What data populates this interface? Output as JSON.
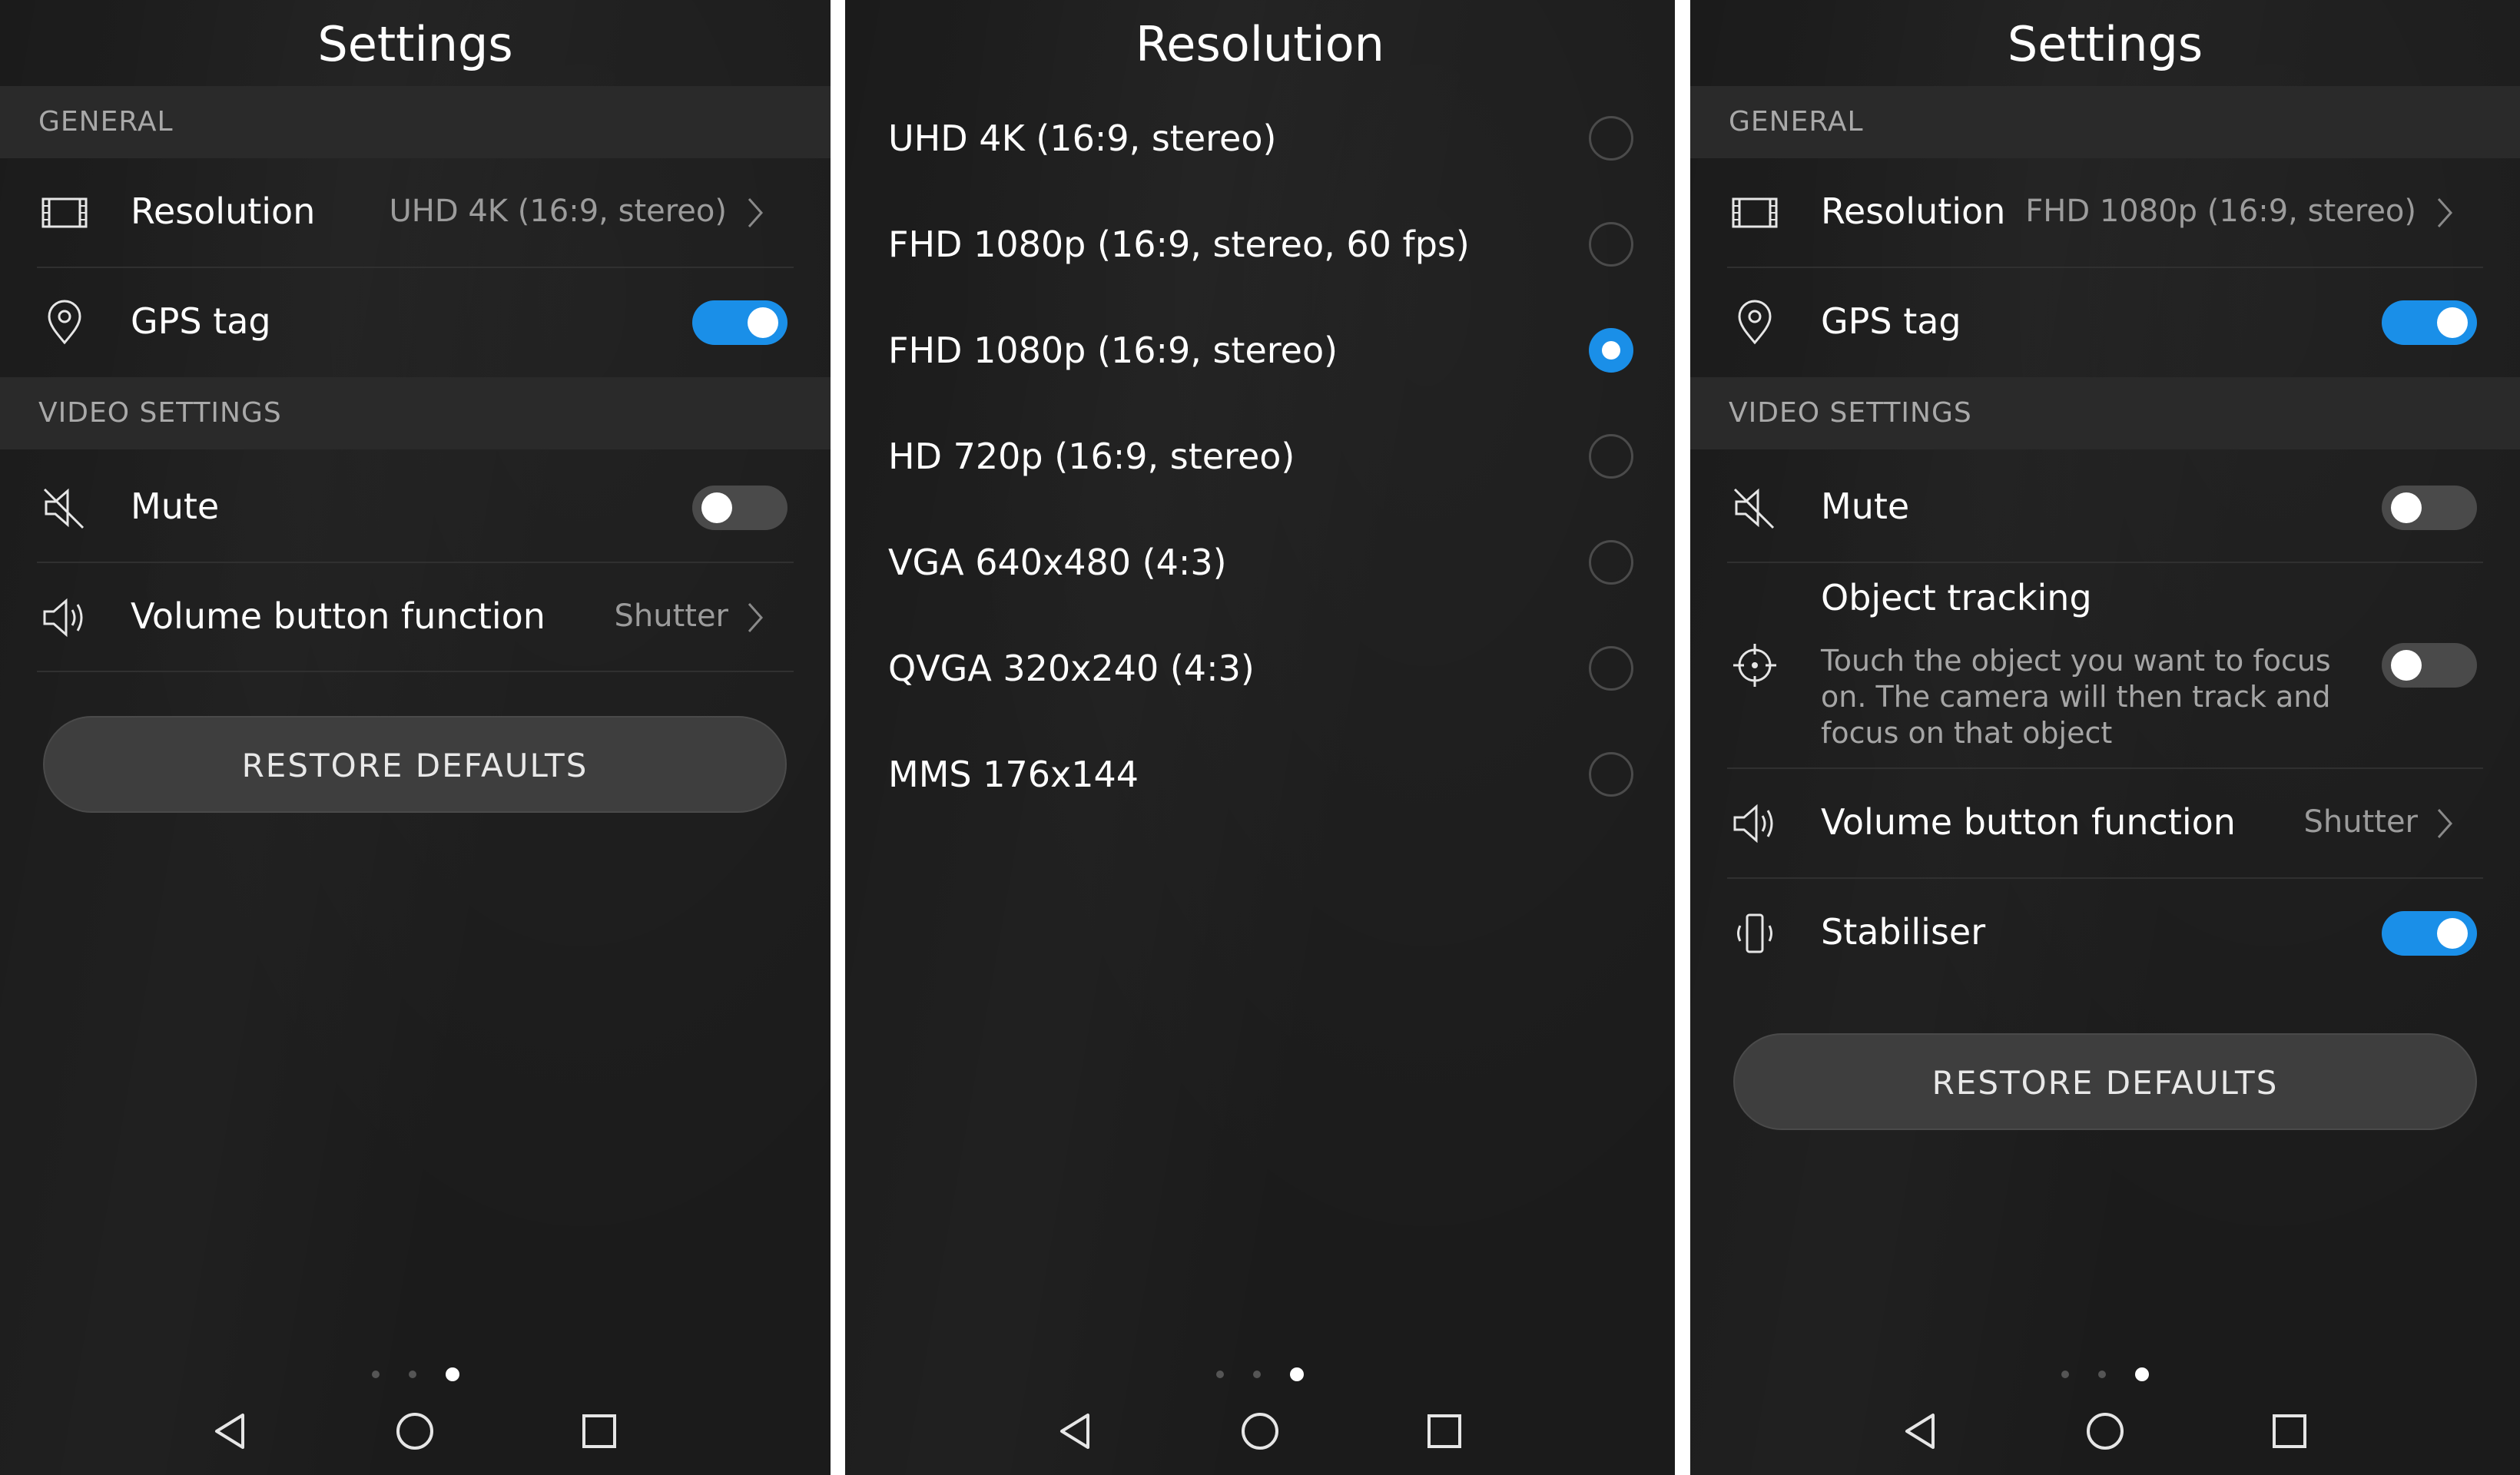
{
  "screens": {
    "settings1": {
      "title": "Settings",
      "section_general": "GENERAL",
      "resolution_label": "Resolution",
      "resolution_value": "UHD 4K (16:9, stereo)",
      "gps_label": "GPS tag",
      "gps_toggle": "on",
      "section_video": "VIDEO SETTINGS",
      "mute_label": "Mute",
      "mute_toggle": "off",
      "volume_label": "Volume button function",
      "volume_value": "Shutter",
      "restore_label": "RESTORE DEFAULTS"
    },
    "resolution": {
      "title": "Resolution",
      "options": [
        {
          "label": "UHD 4K (16:9, stereo)",
          "selected": false
        },
        {
          "label": "FHD 1080p (16:9, stereo, 60 fps)",
          "selected": false
        },
        {
          "label": "FHD 1080p (16:9, stereo)",
          "selected": true
        },
        {
          "label": "HD 720p (16:9, stereo)",
          "selected": false
        },
        {
          "label": "VGA 640x480 (4:3)",
          "selected": false
        },
        {
          "label": "QVGA 320x240 (4:3)",
          "selected": false
        },
        {
          "label": "MMS 176x144",
          "selected": false
        }
      ]
    },
    "settings2": {
      "title": "Settings",
      "section_general": "GENERAL",
      "resolution_label": "Resolution",
      "resolution_value": "FHD 1080p (16:9, stereo)",
      "gps_label": "GPS tag",
      "gps_toggle": "on",
      "section_video": "VIDEO SETTINGS",
      "mute_label": "Mute",
      "mute_toggle": "off",
      "tracking_label": "Object tracking",
      "tracking_desc": "Touch the object you want to focus on. The camera will then track and focus on that object",
      "tracking_toggle": "off",
      "volume_label": "Volume button function",
      "volume_value": "Shutter",
      "stabiliser_label": "Stabiliser",
      "stabiliser_toggle": "on",
      "restore_label": "RESTORE DEFAULTS"
    }
  },
  "page_indicator": {
    "count": 3,
    "active_index": 2
  },
  "nav_icons": [
    "back-icon",
    "home-icon",
    "recents-icon"
  ],
  "colors": {
    "accent": "#1a8fe8",
    "background": "#1b1b1b",
    "section_bg": "#2a2a2a",
    "secondary_text": "#9c9c9c"
  }
}
